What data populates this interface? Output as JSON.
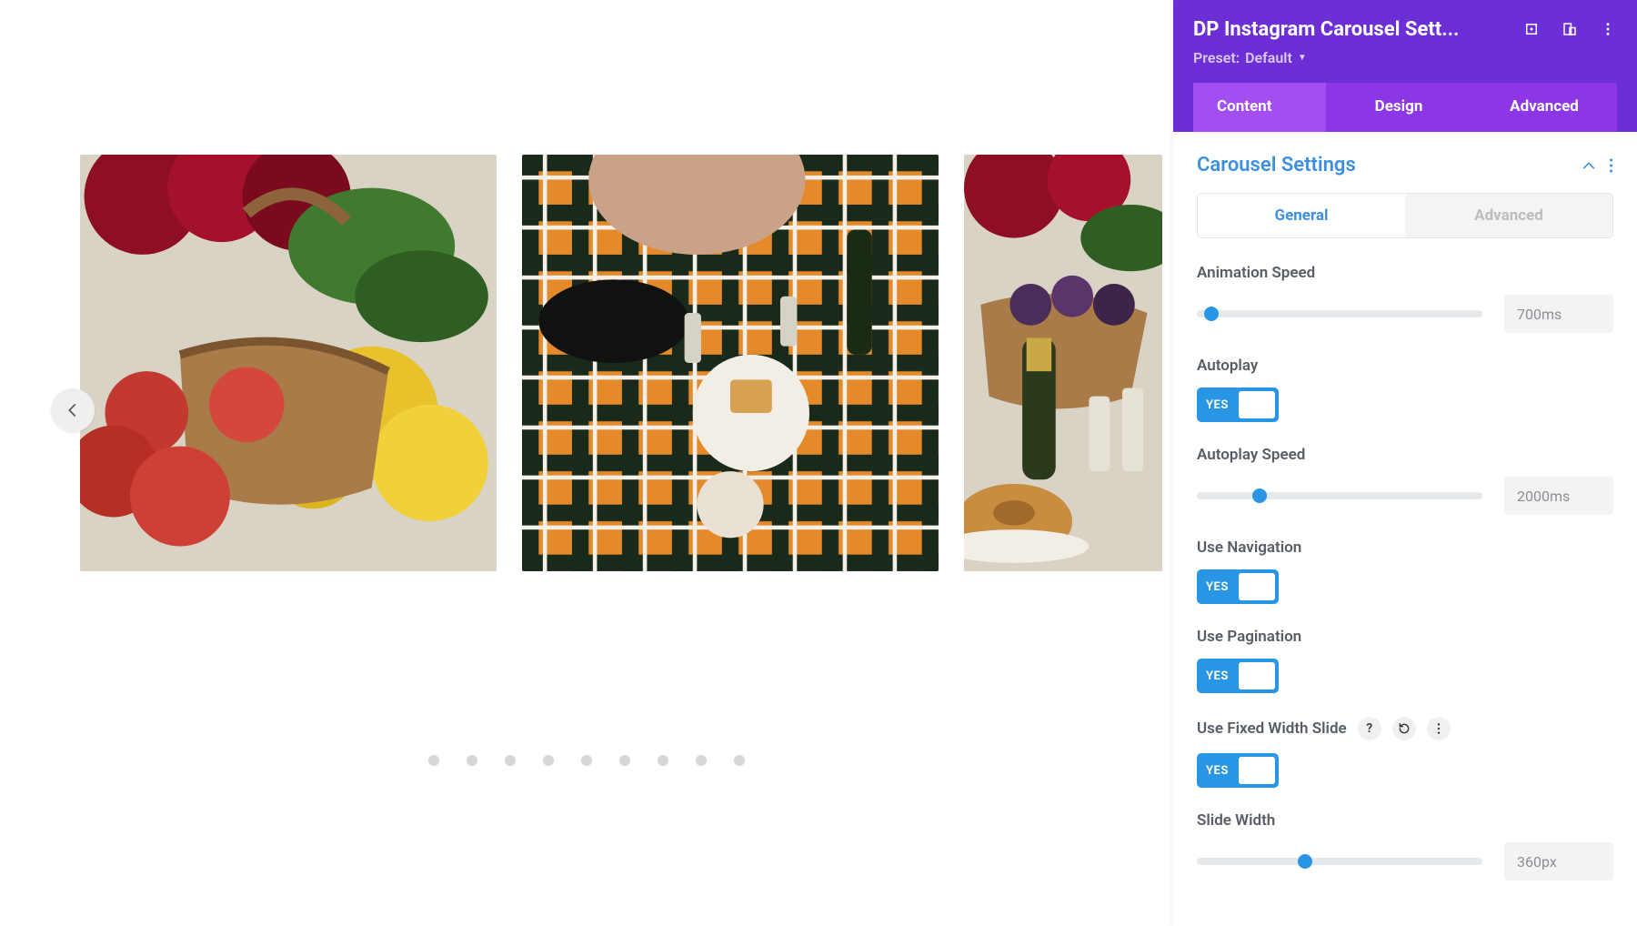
{
  "panel": {
    "title": "DP Instagram Carousel Sett...",
    "preset_label": "Preset:",
    "preset_value": "Default",
    "tabs": {
      "content": "Content",
      "design": "Design",
      "advanced": "Advanced"
    }
  },
  "section": {
    "title": "Carousel Settings",
    "subtabs": {
      "general": "General",
      "advanced": "Advanced"
    }
  },
  "fields": {
    "animation_speed": {
      "label": "Animation Speed",
      "value": "700ms",
      "thumb_pct": 5
    },
    "autoplay": {
      "label": "Autoplay",
      "toggle": "YES"
    },
    "autoplay_speed": {
      "label": "Autoplay Speed",
      "value": "2000ms",
      "thumb_pct": 22
    },
    "use_navigation": {
      "label": "Use Navigation",
      "toggle": "YES"
    },
    "use_pagination": {
      "label": "Use Pagination",
      "toggle": "YES"
    },
    "use_fixed_width": {
      "label": "Use Fixed Width Slide",
      "toggle": "YES"
    },
    "slide_width": {
      "label": "Slide Width",
      "value": "360px",
      "thumb_pct": 38
    }
  },
  "pagination_dots": 9
}
